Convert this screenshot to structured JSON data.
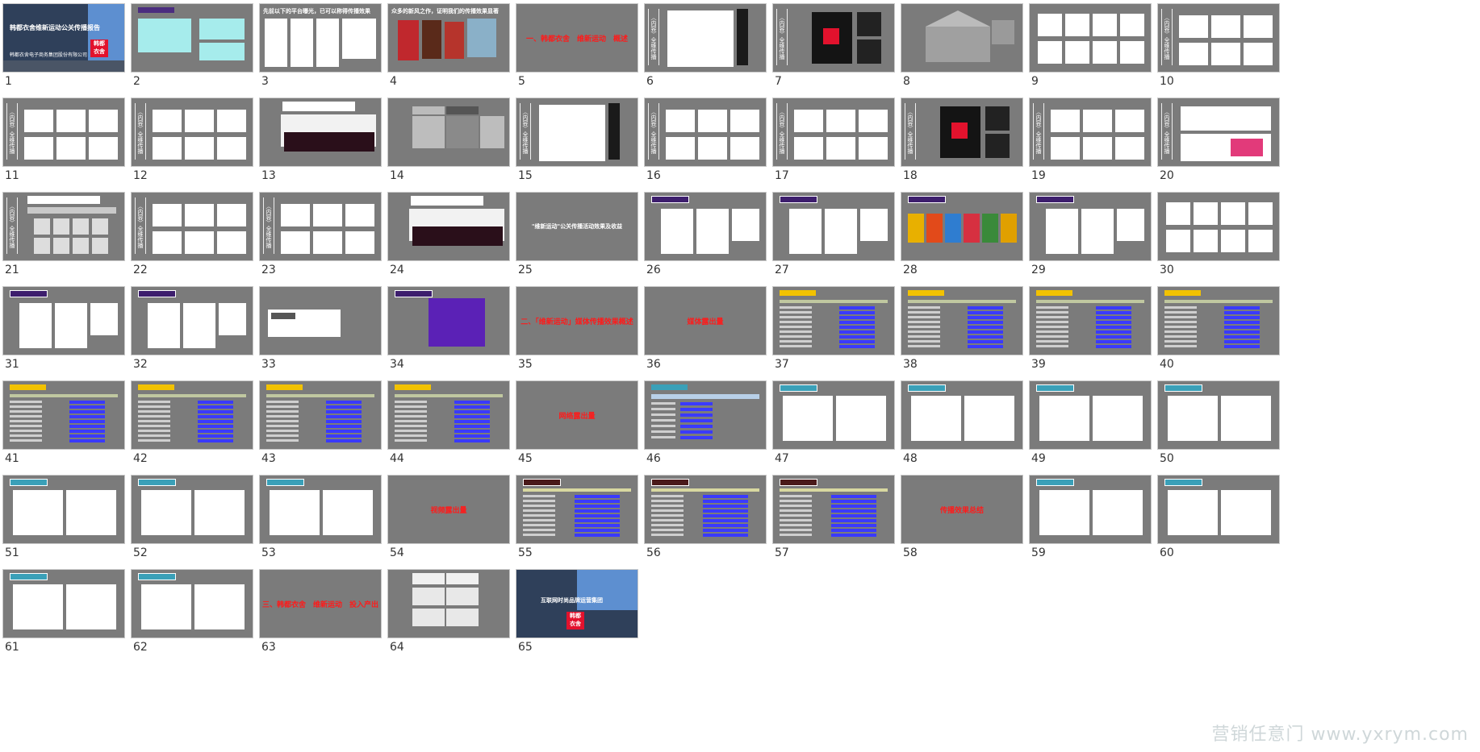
{
  "slides": [
    {
      "n": "1",
      "kind": "cover",
      "title": "韩都衣舍维新运动公关传播报告",
      "subtitle": "韩都衣舍电子商务集团股份有限公司",
      "logo": "韩都\n衣舍"
    },
    {
      "n": "2",
      "kind": "cyan"
    },
    {
      "n": "3",
      "kind": "screens",
      "title": "先前以下的平台曝光，已可以称得传播效果"
    },
    {
      "n": "4",
      "kind": "posters",
      "title": "众多的新风之作，证明我们的传播效果显著"
    },
    {
      "n": "5",
      "kind": "red",
      "text": "一、韩都衣舍　维新运动　概述"
    },
    {
      "n": "6",
      "kind": "side-doc"
    },
    {
      "n": "7",
      "kind": "side-black"
    },
    {
      "n": "8",
      "kind": "house"
    },
    {
      "n": "9",
      "kind": "grid-cards"
    },
    {
      "n": "10",
      "kind": "side-cards"
    },
    {
      "n": "11",
      "kind": "side-cards"
    },
    {
      "n": "12",
      "kind": "side-cards"
    },
    {
      "n": "13",
      "kind": "banner"
    },
    {
      "n": "14",
      "kind": "boxes"
    },
    {
      "n": "15",
      "kind": "side-doc"
    },
    {
      "n": "16",
      "kind": "side-cards"
    },
    {
      "n": "17",
      "kind": "side-cards"
    },
    {
      "n": "18",
      "kind": "side-black"
    },
    {
      "n": "19",
      "kind": "side-cards"
    },
    {
      "n": "20",
      "kind": "side-pink"
    },
    {
      "n": "21",
      "kind": "side-people"
    },
    {
      "n": "22",
      "kind": "side-cards"
    },
    {
      "n": "23",
      "kind": "side-cards"
    },
    {
      "n": "24",
      "kind": "banner"
    },
    {
      "n": "25",
      "kind": "white",
      "text": "\"维新运动\"公关传播活动效果及收益"
    },
    {
      "n": "26",
      "kind": "purple-tag"
    },
    {
      "n": "27",
      "kind": "purple-tag"
    },
    {
      "n": "28",
      "kind": "purple-phones"
    },
    {
      "n": "29",
      "kind": "purple-tag"
    },
    {
      "n": "30",
      "kind": "grid-cards"
    },
    {
      "n": "31",
      "kind": "purple-tag"
    },
    {
      "n": "32",
      "kind": "purple-tag"
    },
    {
      "n": "33",
      "kind": "chart-mini"
    },
    {
      "n": "34",
      "kind": "purple-poster"
    },
    {
      "n": "35",
      "kind": "red",
      "text": "二、「维新运动」媒体传播效果概述"
    },
    {
      "n": "36",
      "kind": "red",
      "text": "媒体露出量"
    },
    {
      "n": "37",
      "kind": "table"
    },
    {
      "n": "38",
      "kind": "table"
    },
    {
      "n": "39",
      "kind": "table"
    },
    {
      "n": "40",
      "kind": "table"
    },
    {
      "n": "41",
      "kind": "table"
    },
    {
      "n": "42",
      "kind": "table"
    },
    {
      "n": "43",
      "kind": "table"
    },
    {
      "n": "44",
      "kind": "table"
    },
    {
      "n": "45",
      "kind": "red",
      "text": "网络露出量"
    },
    {
      "n": "46",
      "kind": "table-blue"
    },
    {
      "n": "47",
      "kind": "blue-tag"
    },
    {
      "n": "48",
      "kind": "blue-tag"
    },
    {
      "n": "49",
      "kind": "blue-tag"
    },
    {
      "n": "50",
      "kind": "blue-tag"
    },
    {
      "n": "51",
      "kind": "blue-tag"
    },
    {
      "n": "52",
      "kind": "blue-tag"
    },
    {
      "n": "53",
      "kind": "blue-tag"
    },
    {
      "n": "54",
      "kind": "red",
      "text": "视频露出量"
    },
    {
      "n": "55",
      "kind": "table-dark"
    },
    {
      "n": "56",
      "kind": "table-dark"
    },
    {
      "n": "57",
      "kind": "table-dark"
    },
    {
      "n": "58",
      "kind": "red",
      "text": "传播效果总结"
    },
    {
      "n": "59",
      "kind": "blue-tag"
    },
    {
      "n": "60",
      "kind": "blue-tag"
    },
    {
      "n": "61",
      "kind": "blue-tag"
    },
    {
      "n": "62",
      "kind": "blue-tag"
    },
    {
      "n": "63",
      "kind": "red",
      "text": "三、韩都衣舍　维新运动　投入产出"
    },
    {
      "n": "64",
      "kind": "in-out"
    },
    {
      "n": "65",
      "kind": "cover-end",
      "title": "互联网时尚品牌运营集团",
      "logo": "韩都\n衣舍"
    }
  ],
  "watermark": "营销任意门 www.yxrym.com"
}
